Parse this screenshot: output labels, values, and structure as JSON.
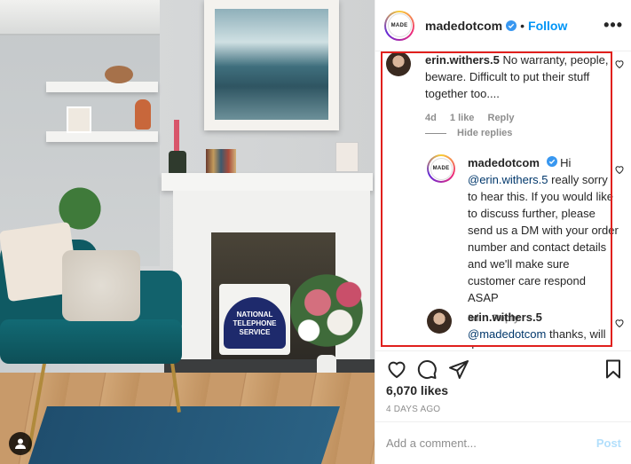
{
  "header": {
    "username": "madedotcom",
    "separator": "•",
    "follow_label": "Follow",
    "more_label": "•••",
    "logo_text": "MADE"
  },
  "comments": [
    {
      "username": "erin.withers.5",
      "text": "No warranty, people, beware. Difficult to put their stuff together too....",
      "time": "4d",
      "likes": "1 like",
      "reply_label": "Reply"
    }
  ],
  "hide_replies_label": "Hide replies",
  "replies": [
    {
      "username": "madedotcom",
      "prefix": "Hi",
      "mention": "@erin.withers.5",
      "text": "really sorry to hear this. If you would like to discuss further, please send us a DM with your order number and contact details and we'll make sure customer care respond ASAP",
      "time": "3d",
      "reply_label": "Reply"
    },
    {
      "username": "erin.withers.5",
      "mention": "@madedotcom",
      "text": "thanks, will do"
    }
  ],
  "photo": {
    "sign_text": "NATIONAL TELEPHONE SERVICE"
  },
  "actions": {
    "like_icon": "heart-icon",
    "comment_icon": "comment-icon",
    "share_icon": "share-icon",
    "save_icon": "bookmark-icon"
  },
  "likes_text": "6,070 likes",
  "timestamp": "4 DAYS AGO",
  "add_comment": {
    "placeholder": "Add a comment...",
    "post_label": "Post"
  },
  "colors": {
    "accent": "#0095f6",
    "highlight": "#e0201d",
    "mention": "#00376b",
    "muted": "#8e8e8e"
  }
}
